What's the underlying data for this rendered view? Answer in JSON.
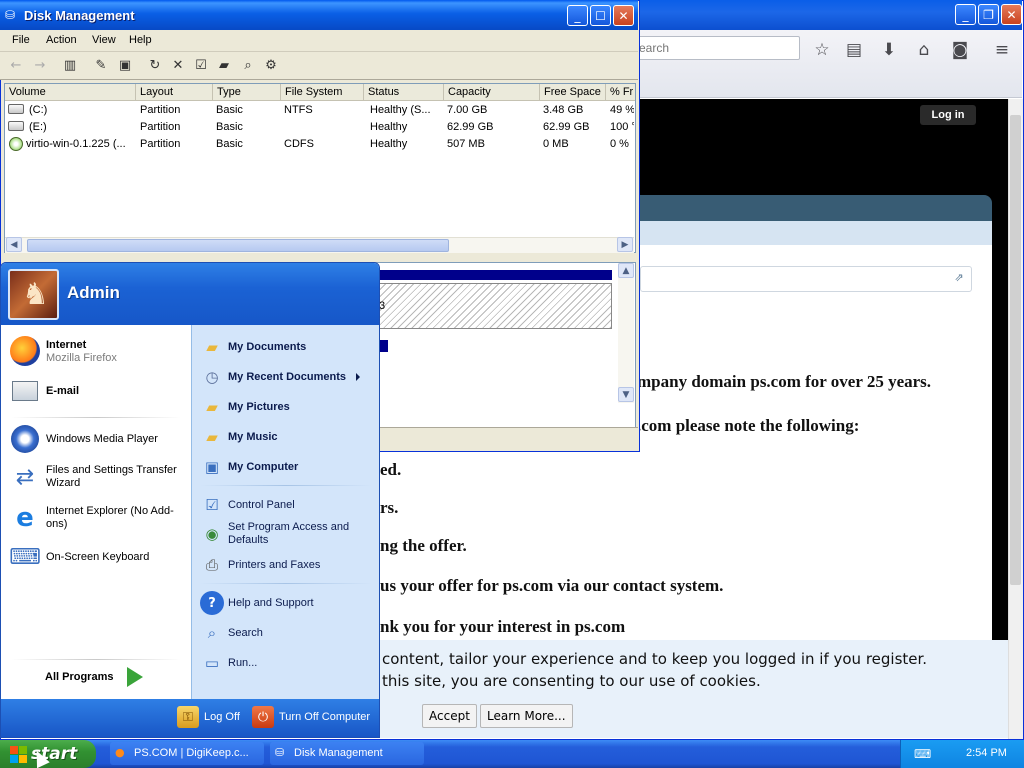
{
  "firefox": {
    "search_placeholder": "earch",
    "login_label": "Log in",
    "page_lines": [
      "mpany domain ps.com for over 25 years.",
      ".com please note the following:",
      "ed.",
      "rs.",
      "ng the offer.",
      "us your offer for ps.com via our contact system.",
      "nk you for your interest in ps.com"
    ],
    "cookie_line1": "content, tailor your experience and to keep you logged in if you register.",
    "cookie_line2": "this site, you are consenting to our use of cookies.",
    "accept_label": "Accept",
    "learn_more_label": "Learn More..."
  },
  "disk_management": {
    "title": "Disk Management",
    "menu": [
      "File",
      "Action",
      "View",
      "Help"
    ],
    "columns": [
      "Volume",
      "Layout",
      "Type",
      "File System",
      "Status",
      "Capacity",
      "Free Space",
      "% Fr"
    ],
    "rows": [
      {
        "volume": "(C:)",
        "layout": "Partition",
        "type": "Basic",
        "fs": "NTFS",
        "status": "Healthy (S...",
        "capacity": "7.00 GB",
        "free": "3.48 GB",
        "pct": "49 %",
        "icon": "disk-icon"
      },
      {
        "volume": "(E:)",
        "layout": "Partition",
        "type": "Basic",
        "fs": "",
        "status": "Healthy",
        "capacity": "62.99 GB",
        "free": "62.99 GB",
        "pct": "100 °",
        "icon": "disk-icon"
      },
      {
        "volume": "virtio-win-0.1.225 (...",
        "layout": "Partition",
        "type": "Basic",
        "fs": "CDFS",
        "status": "Healthy",
        "capacity": "507 MB",
        "free": "0 MB",
        "pct": "0 %",
        "icon": "cd-icon"
      }
    ],
    "graph_label": "3"
  },
  "start_menu": {
    "user": "Admin",
    "pinned": [
      {
        "label": "Internet",
        "sub": "Mozilla Firefox",
        "icon": "firefox-icon"
      },
      {
        "label": "E-mail",
        "sub": "",
        "icon": "email-icon"
      }
    ],
    "recent": [
      {
        "label": "Windows Media Player",
        "icon": "media-player-icon"
      },
      {
        "label": "Files and Settings Transfer Wizard",
        "icon": "transfer-wizard-icon"
      },
      {
        "label": "Internet Explorer (No Add-ons)",
        "icon": "ie-icon"
      },
      {
        "label": "On-Screen Keyboard",
        "icon": "keyboard-icon"
      }
    ],
    "all_programs": "All Programs",
    "right_items": [
      {
        "label": "My Documents",
        "bold": true,
        "icon": "folder-icon"
      },
      {
        "label": "My Recent Documents",
        "bold": true,
        "icon": "recent-docs-icon"
      },
      {
        "label": "My Pictures",
        "bold": true,
        "icon": "pictures-folder-icon"
      },
      {
        "label": "My Music",
        "bold": true,
        "icon": "music-folder-icon"
      },
      {
        "label": "My Computer",
        "bold": true,
        "icon": "computer-icon"
      },
      {
        "label": "Control Panel",
        "bold": false,
        "icon": "control-panel-icon"
      },
      {
        "label": "Set Program Access and Defaults",
        "bold": false,
        "icon": "program-access-icon"
      },
      {
        "label": "Printers and Faxes",
        "bold": false,
        "icon": "printer-icon"
      },
      {
        "label": "Help and Support",
        "bold": false,
        "icon": "help-icon"
      },
      {
        "label": "Search",
        "bold": false,
        "icon": "search-icon"
      },
      {
        "label": "Run...",
        "bold": false,
        "icon": "run-icon"
      }
    ],
    "log_off": "Log Off",
    "turn_off": "Turn Off Computer"
  },
  "taskbar": {
    "start_label": "start",
    "tasks": [
      {
        "label": "PS.COM | DigiKeep.c...",
        "icon": "firefox-icon",
        "active": false
      },
      {
        "label": "Disk Management",
        "icon": "disk-management-icon",
        "active": false
      }
    ],
    "clock": "2:54 PM"
  }
}
